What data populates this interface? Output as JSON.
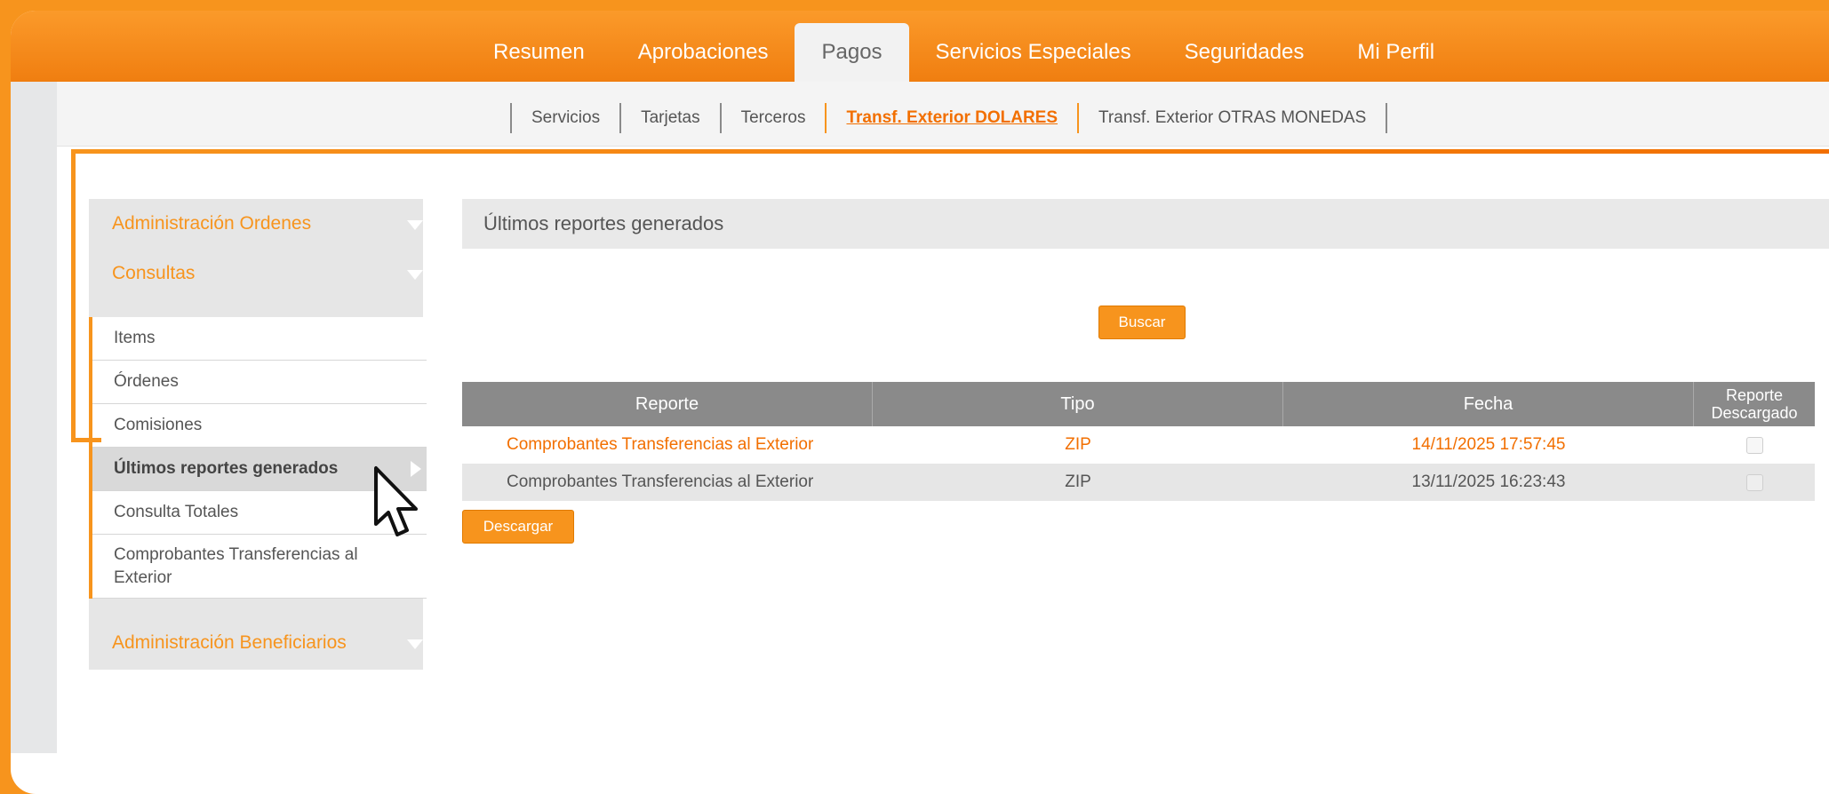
{
  "main_nav": {
    "tabs": [
      {
        "label": "Resumen"
      },
      {
        "label": "Aprobaciones"
      },
      {
        "label": "Pagos"
      },
      {
        "label": "Servicios Especiales"
      },
      {
        "label": "Seguridades"
      },
      {
        "label": "Mi Perfil"
      }
    ],
    "active": "Pagos"
  },
  "sub_nav": {
    "tabs": [
      {
        "label": "Servicios"
      },
      {
        "label": "Tarjetas"
      },
      {
        "label": "Terceros"
      },
      {
        "label": "Transf. Exterior DOLARES"
      },
      {
        "label": "Transf. Exterior OTRAS MONEDAS"
      }
    ],
    "active": "Transf. Exterior DOLARES"
  },
  "sidebar": {
    "groups": [
      {
        "label": "Administración Ordenes"
      },
      {
        "label": "Consultas"
      },
      {
        "label": "Administración Beneficiarios"
      }
    ],
    "items": [
      {
        "label": "Items"
      },
      {
        "label": "Órdenes"
      },
      {
        "label": "Comisiones"
      },
      {
        "label": "Últimos reportes generados"
      },
      {
        "label": "Consulta Totales"
      },
      {
        "label": "Comprobantes Transferencias al Exterior"
      }
    ],
    "active_item": "Últimos reportes generados"
  },
  "panel": {
    "title": "Últimos reportes generados",
    "search_label": "Buscar",
    "download_label": "Descargar"
  },
  "table": {
    "headers": {
      "reporte": "Reporte",
      "tipo": "Tipo",
      "fecha": "Fecha",
      "descargado_1": "Reporte",
      "descargado_2": "Descargado"
    },
    "rows": [
      {
        "reporte": "Comprobantes Transferencias al Exterior",
        "tipo": "ZIP",
        "fecha": "14/11/2025 17:57:45"
      },
      {
        "reporte": "Comprobantes Transferencias al Exterior",
        "tipo": "ZIP",
        "fecha": "13/11/2025 16:23:43"
      }
    ]
  },
  "colors": {
    "brand_orange": "#f7941d",
    "text_gray": "#555555",
    "header_gray": "#8a8a8a"
  },
  "icons": {
    "group_toggle": "triangle-down-icon",
    "active_item_marker": "triangle-right-icon",
    "pointer": "mouse-cursor-icon"
  }
}
